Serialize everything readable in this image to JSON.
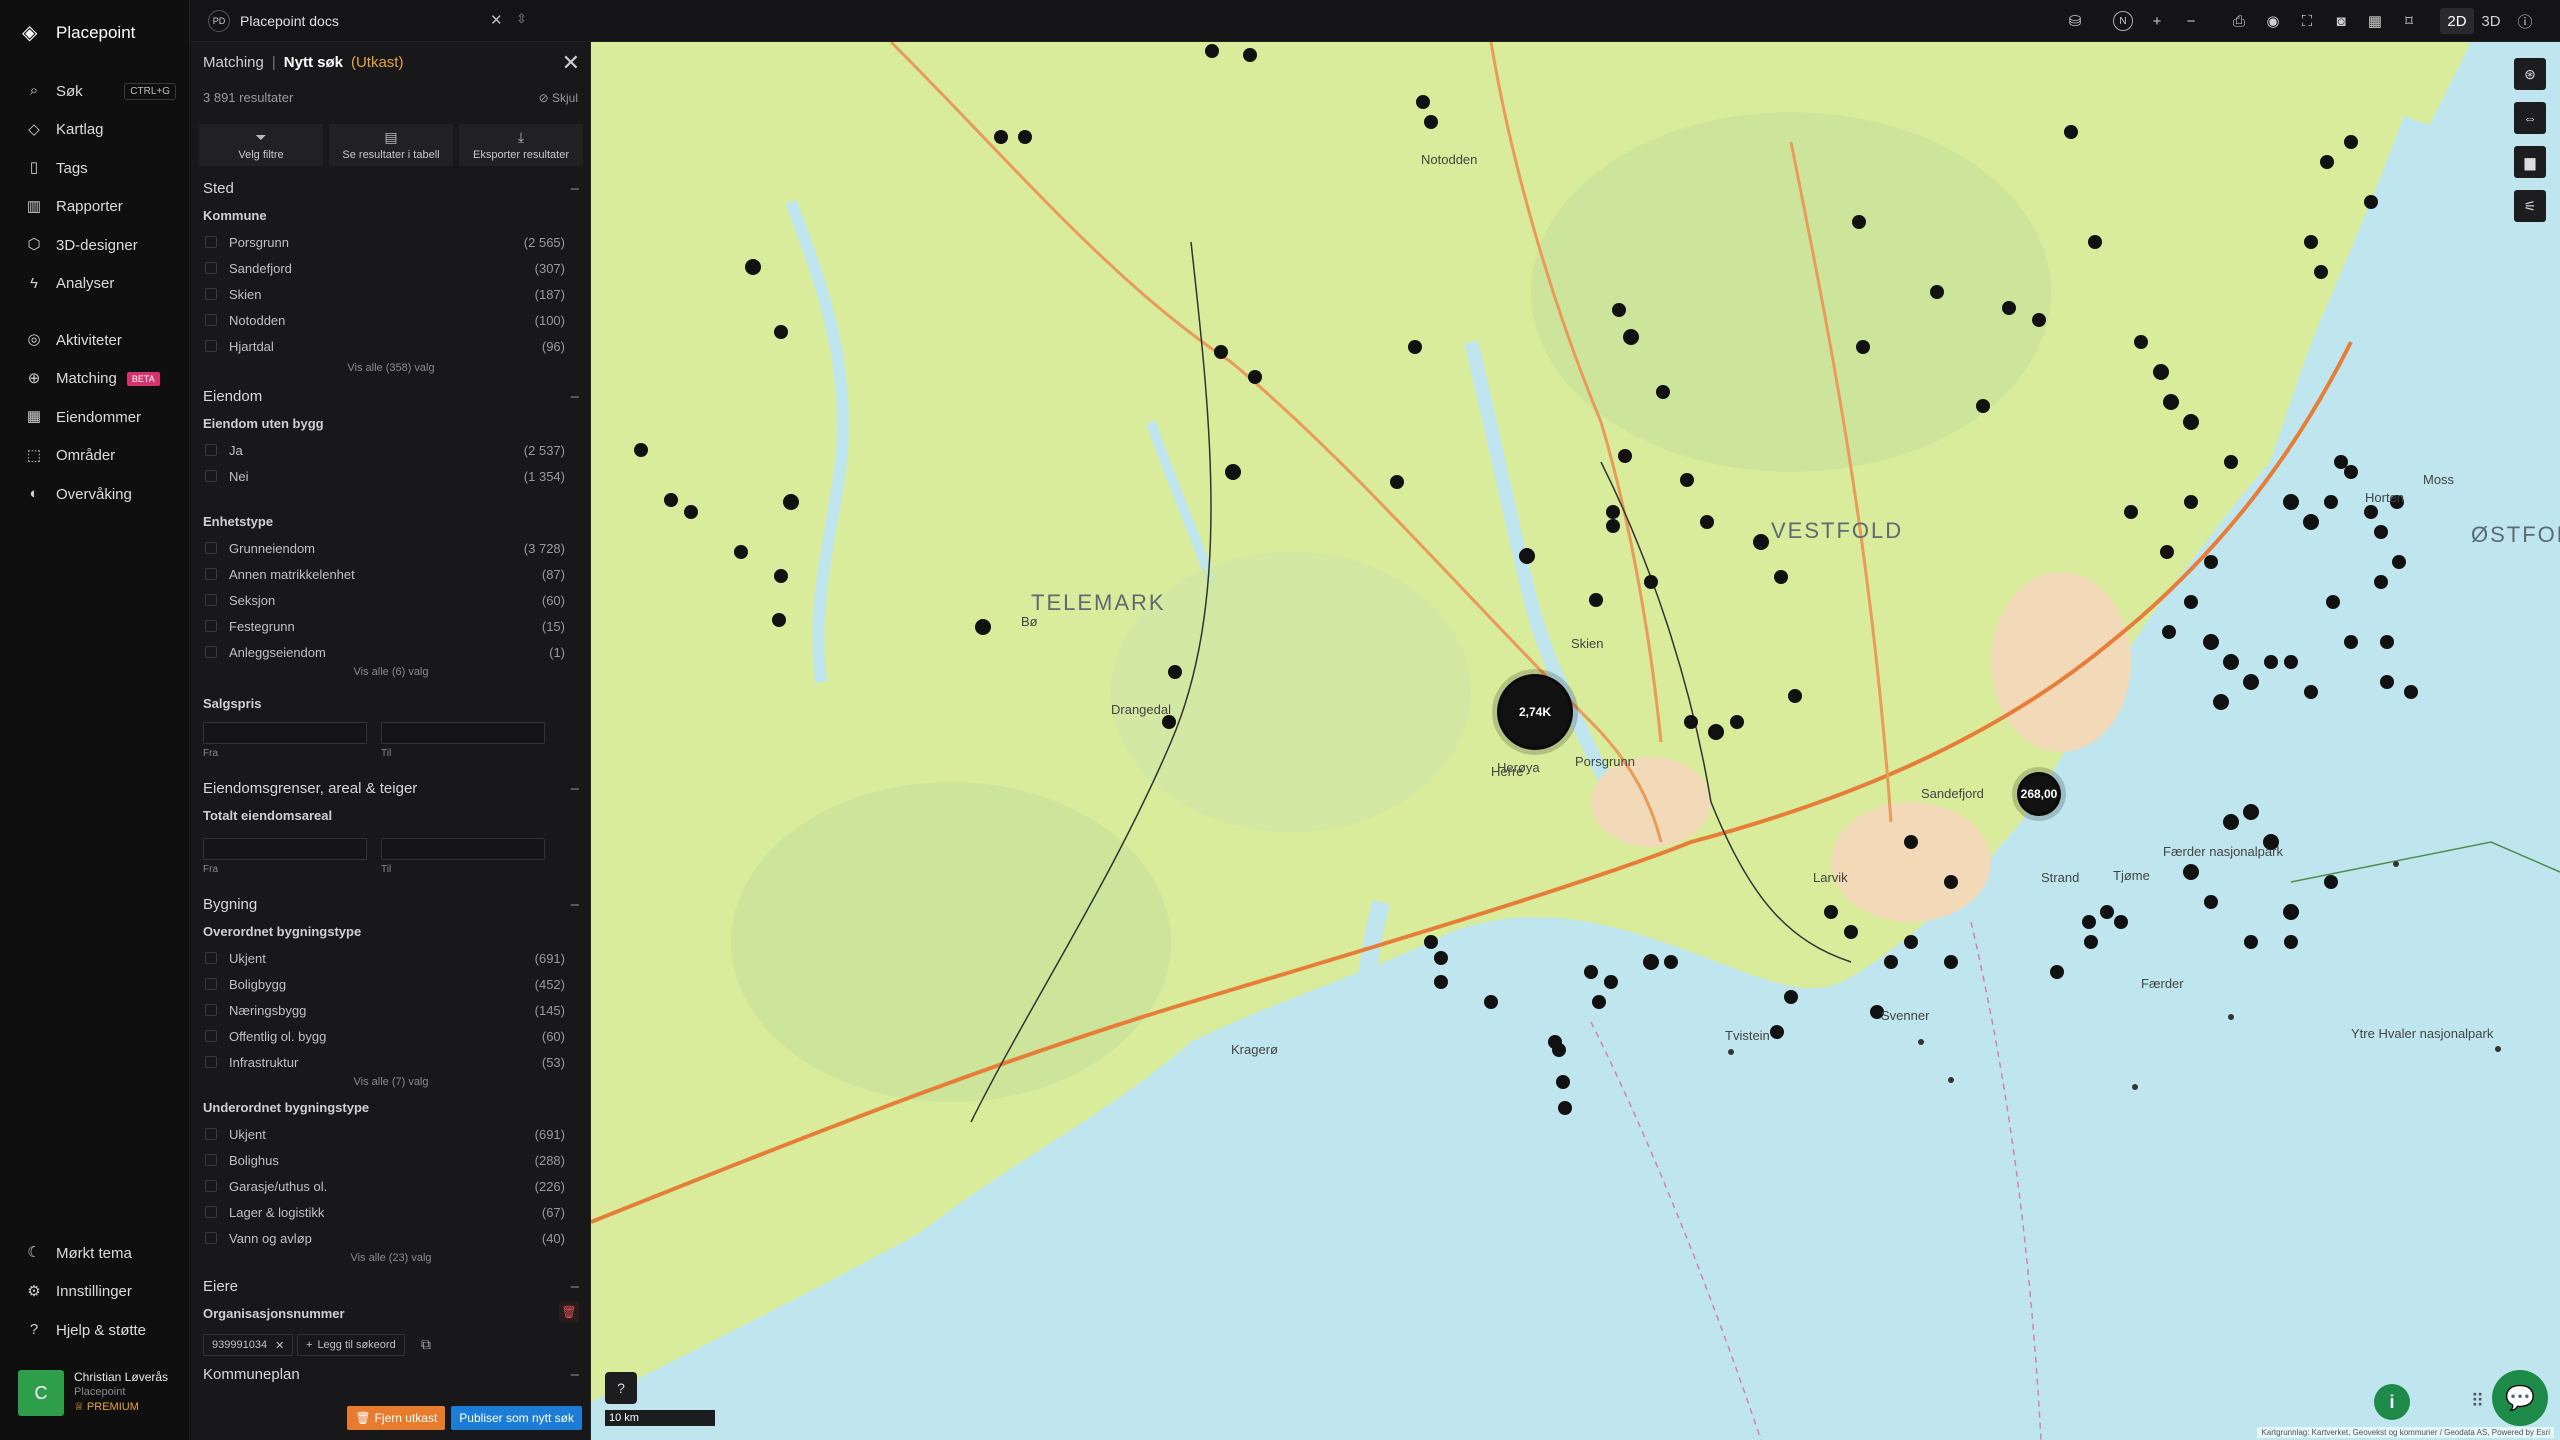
{
  "brand": {
    "name": "Placepoint"
  },
  "nav": {
    "items": [
      {
        "label": "Søk",
        "icon": "search-icon",
        "shortcut": "CTRL+G"
      },
      {
        "label": "Kartlag",
        "icon": "layers-icon"
      },
      {
        "label": "Tags",
        "icon": "bookmark-icon"
      },
      {
        "label": "Rapporter",
        "icon": "bar-chart-icon"
      },
      {
        "label": "3D-designer",
        "icon": "cube-icon"
      },
      {
        "label": "Analyser",
        "icon": "bolt-icon"
      }
    ],
    "items2": [
      {
        "label": "Aktiviteter",
        "icon": "activity-icon"
      },
      {
        "label": "Matching",
        "icon": "target-icon",
        "badge": "BETA"
      },
      {
        "label": "Eiendommer",
        "icon": "building-icon"
      },
      {
        "label": "Områder",
        "icon": "area-icon"
      },
      {
        "label": "Overvåking",
        "icon": "radar-icon"
      }
    ],
    "bottom": [
      {
        "label": "Mørkt tema",
        "icon": "moon-icon"
      },
      {
        "label": "Innstillinger",
        "icon": "gear-icon"
      },
      {
        "label": "Hjelp & støtte",
        "icon": "help-icon"
      }
    ]
  },
  "user": {
    "initial": "C",
    "name": "Christian Løverås",
    "org": "Placepoint",
    "tier": "PREMIUM"
  },
  "workspace": {
    "badge": "PD",
    "name": "Placepoint docs"
  },
  "topbar": {
    "mode_2d": "2D",
    "mode_3d": "3D",
    "compass": "N"
  },
  "panel": {
    "crumb": "Matching",
    "title": "Nytt søk",
    "draft": "(Utkast)",
    "results": "3 891 resultater",
    "hide": "Skjul",
    "actions": [
      {
        "label": "Velg filtre",
        "icon": "filter-icon"
      },
      {
        "label": "Se resultater i tabell",
        "icon": "table-icon"
      },
      {
        "label": "Eksporter resultater",
        "icon": "download-icon"
      }
    ],
    "sted": {
      "title": "Sted",
      "kommune": {
        "label": "Kommune",
        "options": [
          {
            "name": "Porsgrunn",
            "count": "(2 565)"
          },
          {
            "name": "Sandefjord",
            "count": "(307)"
          },
          {
            "name": "Skien",
            "count": "(187)"
          },
          {
            "name": "Notodden",
            "count": "(100)"
          },
          {
            "name": "Hjartdal",
            "count": "(96)"
          }
        ],
        "more": "Vis alle (358) valg"
      }
    },
    "eiendom": {
      "title": "Eiendom",
      "uten_bygg": {
        "label": "Eiendom uten bygg",
        "options": [
          {
            "name": "Ja",
            "count": "(2 537)"
          },
          {
            "name": "Nei",
            "count": "(1 354)"
          }
        ]
      },
      "enhetstype": {
        "label": "Enhetstype",
        "options": [
          {
            "name": "Grunneiendom",
            "count": "(3 728)"
          },
          {
            "name": "Annen matrikkelenhet",
            "count": "(87)"
          },
          {
            "name": "Seksjon",
            "count": "(60)"
          },
          {
            "name": "Festegrunn",
            "count": "(15)"
          },
          {
            "name": "Anleggseiendom",
            "count": "(1)"
          }
        ],
        "more": "Vis alle (6) valg"
      },
      "salgspris": {
        "label": "Salgspris",
        "from": "Fra",
        "to": "Til"
      }
    },
    "grenser": {
      "title": "Eiendomsgrenser, areal & teiger",
      "areal": {
        "label": "Totalt eiendomsareal",
        "from": "Fra",
        "to": "Til"
      }
    },
    "bygning": {
      "title": "Bygning",
      "overordnet": {
        "label": "Overordnet bygningstype",
        "options": [
          {
            "name": "Ukjent",
            "count": "(691)"
          },
          {
            "name": "Boligbygg",
            "count": "(452)"
          },
          {
            "name": "Næringsbygg",
            "count": "(145)"
          },
          {
            "name": "Offentlig ol. bygg",
            "count": "(60)"
          },
          {
            "name": "Infrastruktur",
            "count": "(53)"
          }
        ],
        "more": "Vis alle (7) valg"
      },
      "underordnet": {
        "label": "Underordnet bygningstype",
        "options": [
          {
            "name": "Ukjent",
            "count": "(691)"
          },
          {
            "name": "Bolighus",
            "count": "(288)"
          },
          {
            "name": "Garasje/uthus ol.",
            "count": "(226)"
          },
          {
            "name": "Lager & logistikk",
            "count": "(67)"
          },
          {
            "name": "Vann og avløp",
            "count": "(40)"
          }
        ],
        "more": "Vis alle (23) valg"
      }
    },
    "eiere": {
      "title": "Eiere",
      "org_label": "Organisasjonsnummer",
      "tag": "939991034",
      "add": "Legg til søkeord"
    },
    "kommuneplan": {
      "title": "Kommuneplan"
    },
    "remove_draft": "Fjern utkast",
    "publish": "Publiser som nytt søk"
  },
  "map": {
    "places": {
      "telemark": "TELEMARK",
      "vestfold": "VESTFOLD",
      "ostfold": "ØSTFOLD",
      "skien": "Skien",
      "porsgrunn": "Porsgrunn",
      "sandefjord": "Sandefjord",
      "larvik": "Larvik",
      "notodden": "Notodden",
      "bo": "Bø",
      "herre": "Herre",
      "horten": "Horten",
      "moss": "Moss",
      "tjome": "Tjøme",
      "svenner": "Svenner",
      "tvistein": "Tvistein",
      "faerder": "Færder",
      "strand": "Strand",
      "kragero": "Kragerø",
      "drangedal": "Drangedal",
      "heroya": "Herøya",
      "ytre_hvaler": "Ytre Hvaler nasjonalpark",
      "faerder_np": "Færder nasjonalpark"
    },
    "clusters": [
      {
        "label": "2,74K"
      },
      {
        "label": "268,00"
      }
    ],
    "scale": "10 km",
    "attribution": "Kartgrunnlag: Kartverket, Geovekst og kommuner / Geodata AS, Powered by Esri"
  },
  "colors": {
    "accent_orange": "#e7a33b",
    "publish_blue": "#1c7cd6",
    "success_green": "#1e8a4a",
    "beta_pink": "#d6336c"
  }
}
